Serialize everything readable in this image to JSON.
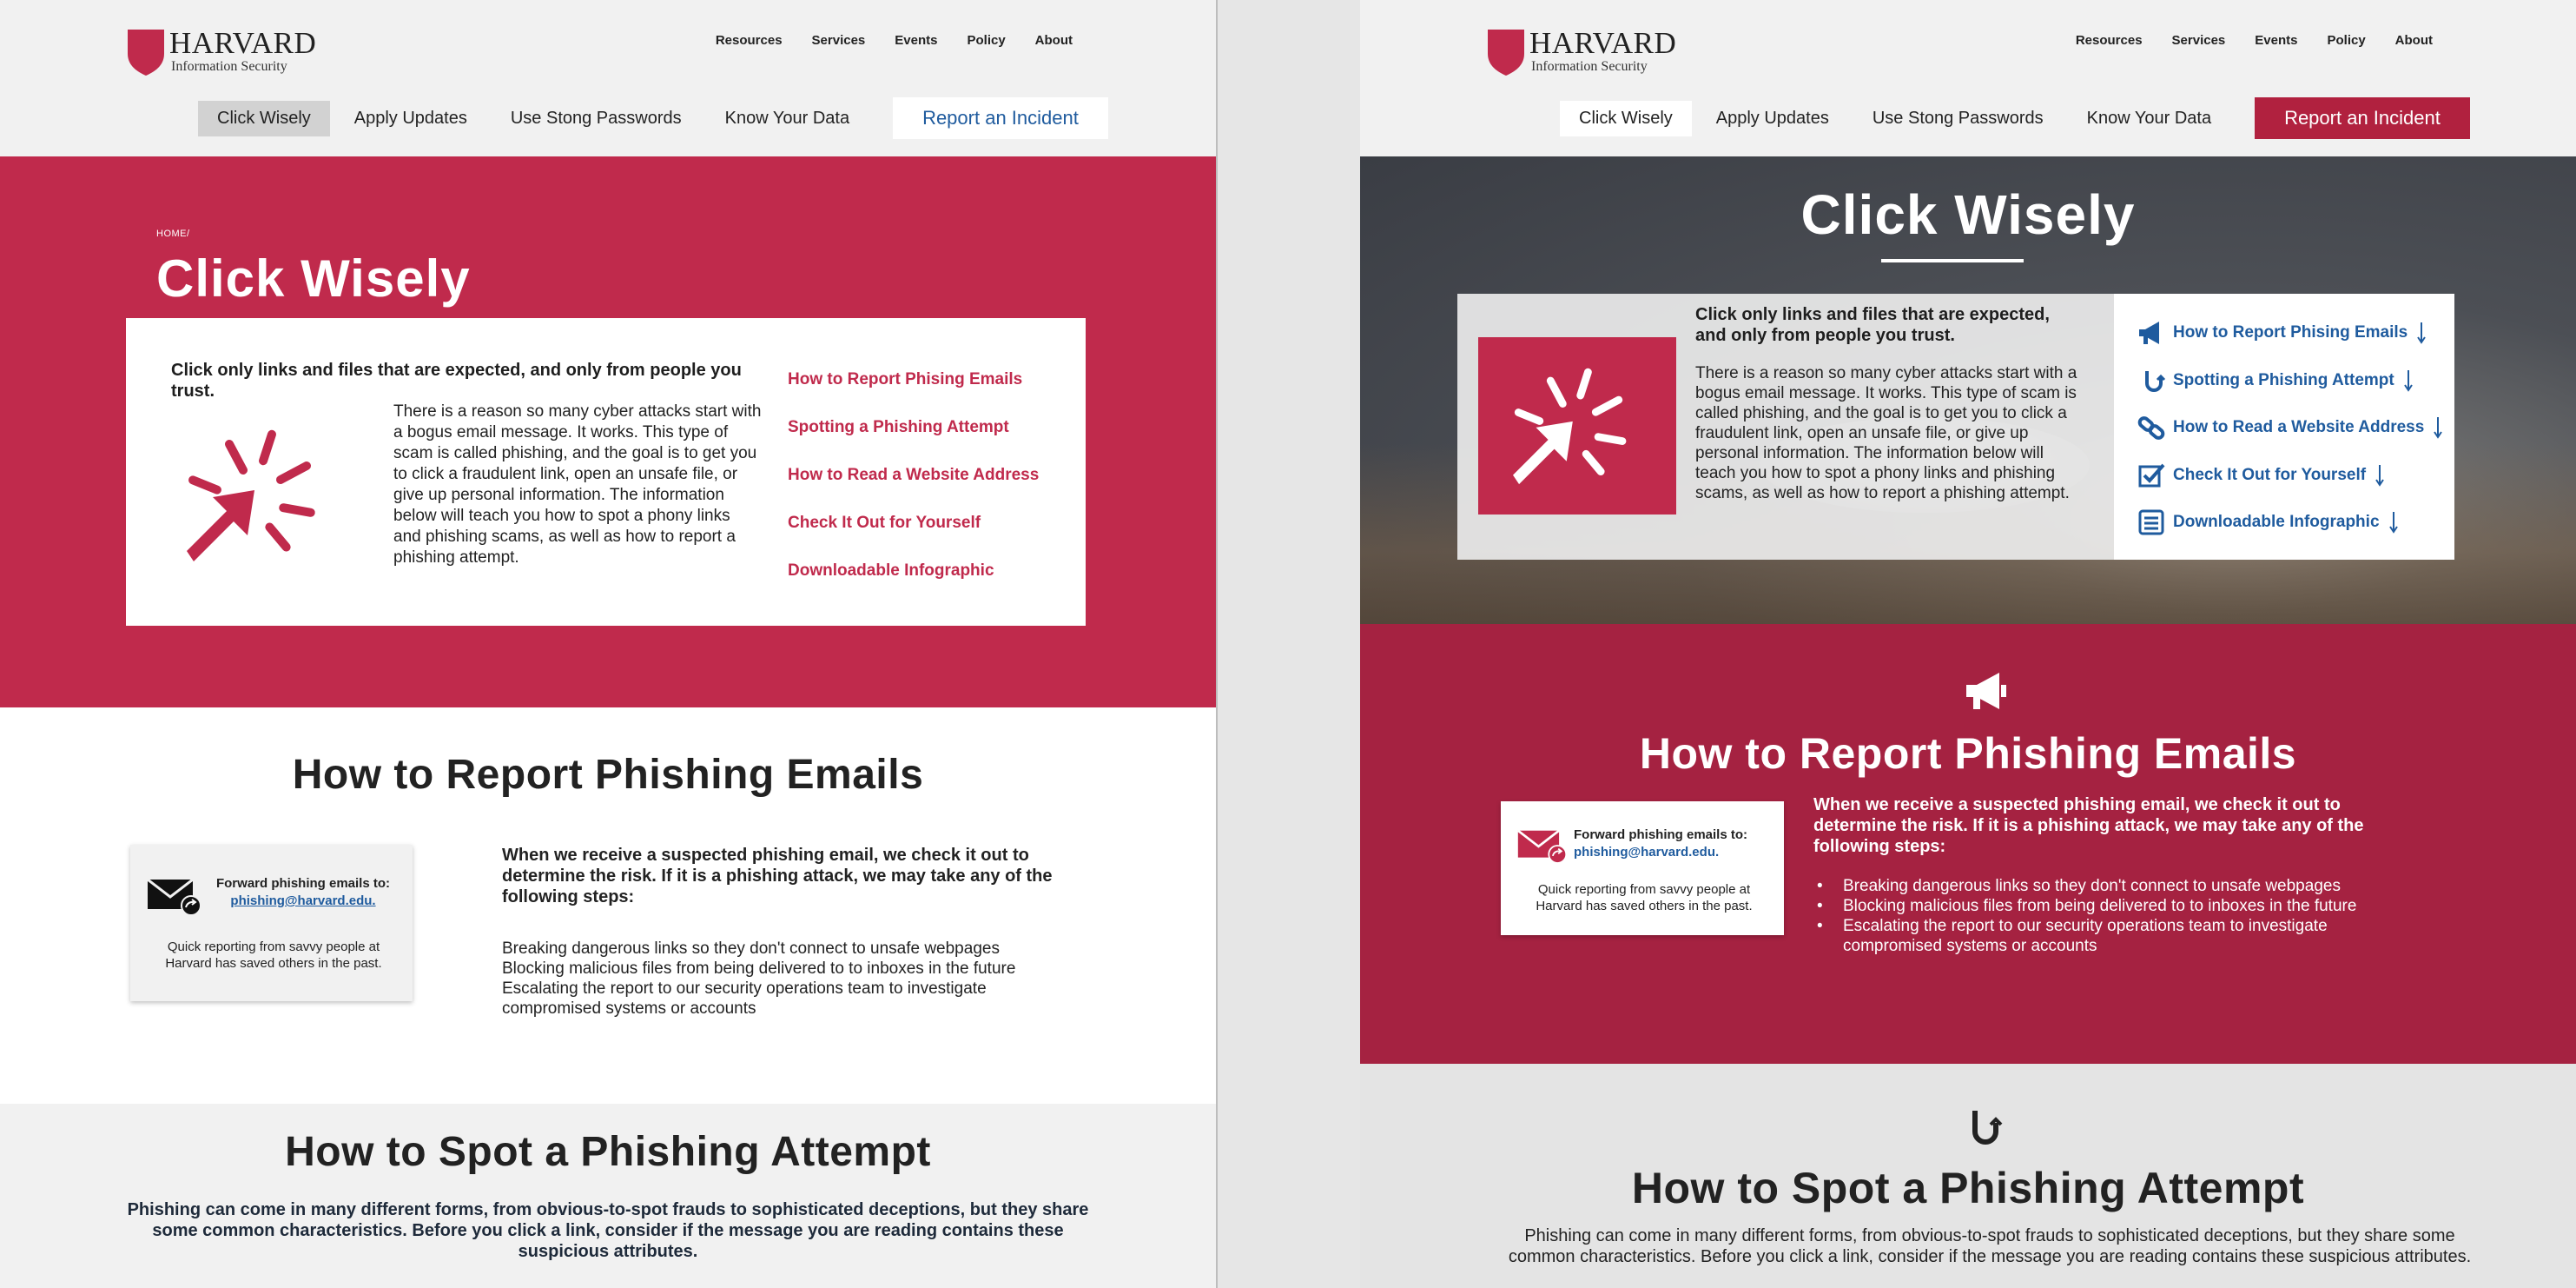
{
  "brand": {
    "title": "HARVARD",
    "subtitle": "Information Security"
  },
  "top_nav": [
    "Resources",
    "Services",
    "Events",
    "Policy",
    "About"
  ],
  "tabs": [
    "Click Wisely",
    "Apply Updates",
    "Use Stong Passwords",
    "Know Your Data"
  ],
  "report_button": "Report an Incident",
  "breadcrumb": "HOME/",
  "page_title": "Click Wisely",
  "intro": {
    "lead": "Click only links and files that are expected, and only from people you trust.",
    "body": "There is a reason so many cyber attacks start with a bogus email message. It works. This type of scam is called phishing, and the goal is to get you to click a fraudulent link, open an unsafe file, or give up personal information. The information below will teach you how to spot a phony links and phishing scams, as well as how to report a phishing attempt."
  },
  "jump_links": [
    {
      "label": "How to Report Phising Emails",
      "icon": "megaphone-icon"
    },
    {
      "label": "Spotting a Phishing Attempt",
      "icon": "hook-icon"
    },
    {
      "label": "How to Read a Website Address",
      "icon": "link-icon"
    },
    {
      "label": "Check It Out for Yourself",
      "icon": "checkbox-icon"
    },
    {
      "label": "Downloadable Infographic",
      "icon": "document-icon"
    }
  ],
  "report_section": {
    "heading": "How to Report Phishing Emails",
    "forward_title": "Forward phishing emails to:",
    "forward_email": "phishing@harvard.edu.",
    "forward_note": "Quick reporting from savvy people at Harvard has saved others in the past.",
    "steps_lead": "When we receive a suspected phishing email, we check it out to determine the risk. If it is a phishing attack, we may take any of the following steps:",
    "steps": [
      "Breaking dangerous links so they don't connect to unsafe webpages",
      "Blocking malicious files from being delivered to to inboxes in the future",
      "Escalating the report to our security operations team to investigate compromised systems or accounts"
    ]
  },
  "spot_section": {
    "heading": "How to Spot a Phishing Attempt",
    "text": "Phishing can come in many different forms, from obvious-to-spot frauds to sophisticated deceptions, but they share some common characteristics. Before you click a link, consider if the message you are reading contains these suspicious attributes."
  },
  "colors": {
    "crimson": "#c02a4c",
    "dark_crimson": "#a52241",
    "link_blue": "#1f5b9e",
    "button_red": "#b1213f"
  }
}
